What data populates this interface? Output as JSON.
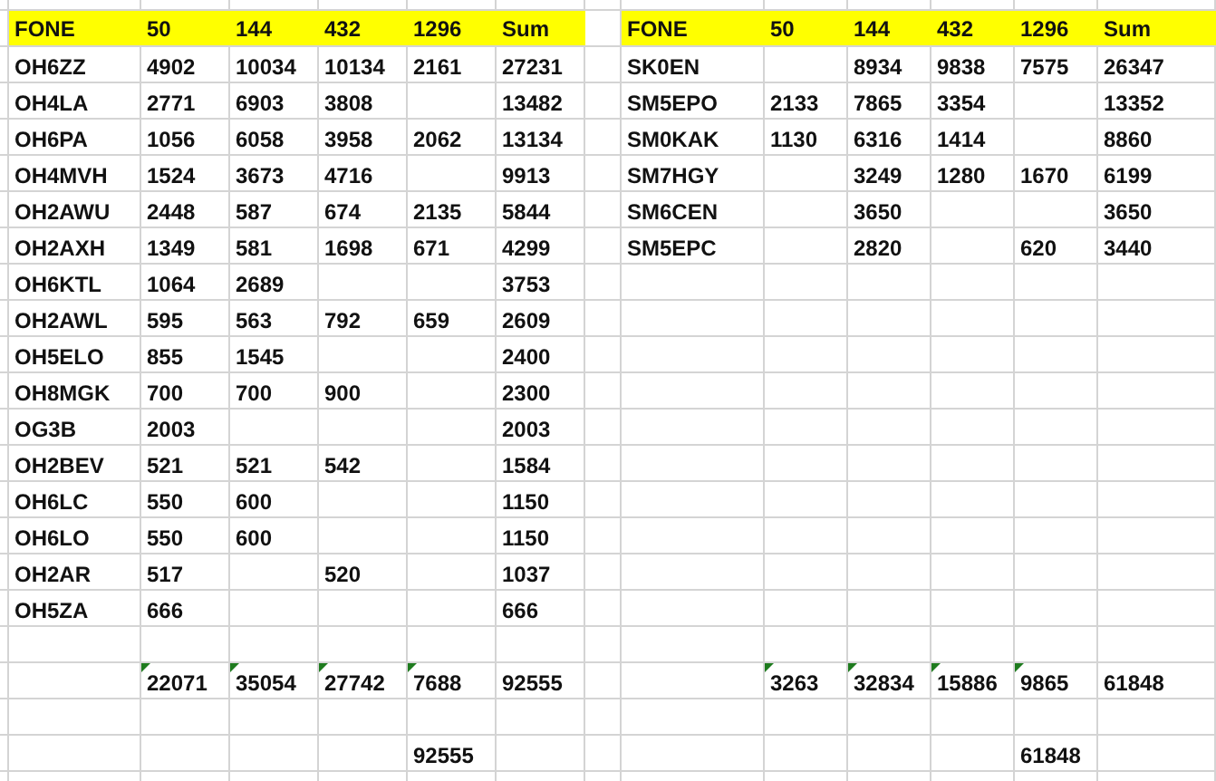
{
  "tables": [
    {
      "header": [
        "FONE",
        "50",
        "144",
        "432",
        "1296",
        "Sum"
      ],
      "rows": [
        [
          "OH6ZZ",
          "4902",
          "10034",
          "10134",
          "2161",
          "27231"
        ],
        [
          "OH4LA",
          "2771",
          "6903",
          "3808",
          "",
          "13482"
        ],
        [
          "OH6PA",
          "1056",
          "6058",
          "3958",
          "2062",
          "13134"
        ],
        [
          "OH4MVH",
          "1524",
          "3673",
          "4716",
          "",
          "9913"
        ],
        [
          "OH2AWU",
          "2448",
          "587",
          "674",
          "2135",
          "5844"
        ],
        [
          "OH2AXH",
          "1349",
          "581",
          "1698",
          "671",
          "4299"
        ],
        [
          "OH6KTL",
          "1064",
          "2689",
          "",
          "",
          "3753"
        ],
        [
          "OH2AWL",
          "595",
          "563",
          "792",
          "659",
          "2609"
        ],
        [
          "OH5ELO",
          "855",
          "1545",
          "",
          "",
          "2400"
        ],
        [
          "OH8MGK",
          "700",
          "700",
          "900",
          "",
          "2300"
        ],
        [
          "OG3B",
          "2003",
          "",
          "",
          "",
          "2003"
        ],
        [
          "OH2BEV",
          "521",
          "521",
          "542",
          "",
          "1584"
        ],
        [
          "OH6LC",
          "550",
          "600",
          "",
          "",
          "1150"
        ],
        [
          "OH6LO",
          "550",
          "600",
          "",
          "",
          "1150"
        ],
        [
          "OH2AR",
          "517",
          "",
          "520",
          "",
          "1037"
        ],
        [
          "OH5ZA",
          "666",
          "",
          "",
          "",
          "666"
        ]
      ],
      "totals": [
        {
          "value": "22071",
          "flagged": true
        },
        {
          "value": "35054",
          "flagged": true
        },
        {
          "value": "27742",
          "flagged": true
        },
        {
          "value": "7688",
          "flagged": true
        },
        {
          "value": "92555",
          "flagged": false
        }
      ],
      "grand_total": "92555"
    },
    {
      "header": [
        "FONE",
        "50",
        "144",
        "432",
        "1296",
        "Sum"
      ],
      "rows": [
        [
          "SK0EN",
          "",
          "8934",
          "9838",
          "7575",
          "26347"
        ],
        [
          "SM5EPO",
          "2133",
          "7865",
          "3354",
          "",
          "13352"
        ],
        [
          "SM0KAK",
          "1130",
          "6316",
          "1414",
          "",
          "8860"
        ],
        [
          "SM7HGY",
          "",
          "3249",
          "1280",
          "1670",
          "6199"
        ],
        [
          "SM6CEN",
          "",
          "3650",
          "",
          "",
          "3650"
        ],
        [
          "SM5EPC",
          "",
          "2820",
          "",
          "620",
          "3440"
        ]
      ],
      "totals": [
        {
          "value": "3263",
          "flagged": true
        },
        {
          "value": "32834",
          "flagged": true
        },
        {
          "value": "15886",
          "flagged": true
        },
        {
          "value": "9865",
          "flagged": true
        },
        {
          "value": "61848",
          "flagged": false
        }
      ],
      "grand_total": "61848"
    }
  ]
}
